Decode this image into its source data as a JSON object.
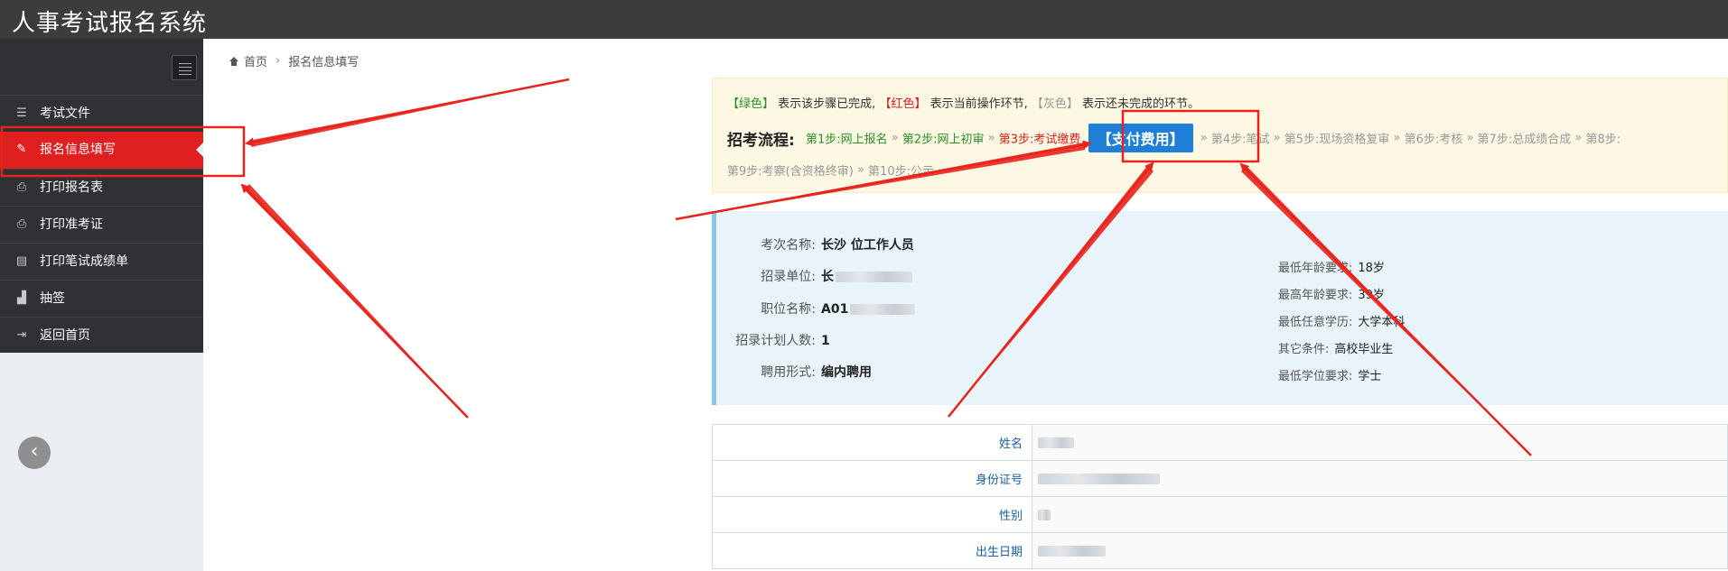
{
  "app": {
    "title": "人事考试报名系统"
  },
  "sidebar": {
    "items": [
      {
        "label": "考试文件",
        "icon": "list-icon"
      },
      {
        "label": "报名信息填写",
        "icon": "edit-icon",
        "active": true
      },
      {
        "label": "打印报名表",
        "icon": "print-icon"
      },
      {
        "label": "打印准考证",
        "icon": "print-icon"
      },
      {
        "label": "打印笔试成绩单",
        "icon": "file-icon"
      },
      {
        "label": "抽签",
        "icon": "signal-icon"
      },
      {
        "label": "返回首页",
        "icon": "sign-out-icon"
      }
    ]
  },
  "breadcrumb": {
    "home": "首页",
    "sep": "›",
    "current": "报名信息填写"
  },
  "flow": {
    "legend": {
      "green": "【绿色】",
      "green_text": "表示该步骤已完成,",
      "red": "【红色】",
      "red_text": "表示当前操作环节,",
      "gray": "【灰色】",
      "gray_text": "表示还未完成的环节。"
    },
    "title": "招考流程:",
    "arrow": "»",
    "step1": "第1步:网上报名",
    "step2": "第2步:网上初审",
    "step3": "第3步:考试缴费",
    "pay_button": "【支付费用】",
    "step4": "第4步:笔试",
    "step5": "第5步:现场资格复审",
    "step6": "第6步:考核",
    "step7": "第7步:总成绩合成",
    "step8": "第8步:",
    "step9": "第9步:考察(含资格终审)",
    "step10": "第10步:公示"
  },
  "exam_info": {
    "left": [
      {
        "label": "考次名称:",
        "value": "长沙   位工作人员"
      },
      {
        "label": "招录单位:",
        "value": "长"
      },
      {
        "label": "职位名称:",
        "value": "A01"
      },
      {
        "label": "招录计划人数:",
        "value": "1"
      },
      {
        "label": "聘用形式:",
        "value": "编内聘用"
      }
    ],
    "right": [
      {
        "label": "最低年龄要求:",
        "value": "18岁"
      },
      {
        "label": "最高年龄要求:",
        "value": "39岁"
      },
      {
        "label": "最低任意学历:",
        "value": "大学本科"
      },
      {
        "label": "其它条件:",
        "value": "高校毕业生"
      },
      {
        "label": "最低学位要求:",
        "value": "学士"
      }
    ]
  },
  "form": {
    "rows": [
      {
        "label": "姓名"
      },
      {
        "label": "身份证号"
      },
      {
        "label": "性别"
      },
      {
        "label": "出生日期"
      }
    ]
  },
  "colors": {
    "topbar": "#3c3c3c",
    "sidebar": "#2f3135",
    "active": "#e02020",
    "pay_button": "#1f7ed6",
    "annotation": "#e8231c"
  }
}
